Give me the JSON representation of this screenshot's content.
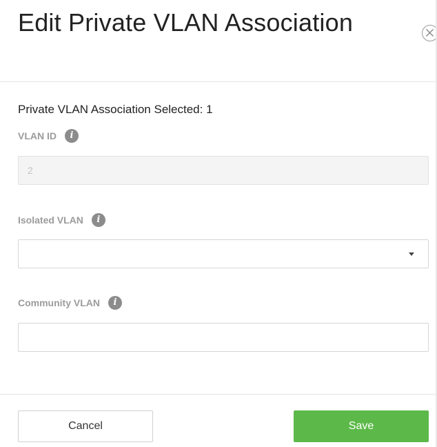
{
  "dialog": {
    "title": "Edit Private VLAN Association",
    "close_icon": "close-circle-icon",
    "selected_text": "Private VLAN Association Selected: 1"
  },
  "fields": {
    "vlan_id": {
      "label": "VLAN ID",
      "value": "2",
      "info_icon": "info-icon",
      "disabled": true
    },
    "isolated_vlan": {
      "label": "Isolated VLAN",
      "value": "",
      "info_icon": "info-icon",
      "type": "dropdown"
    },
    "community_vlan": {
      "label": "Community VLAN",
      "value": "",
      "info_icon": "info-icon",
      "type": "text"
    }
  },
  "footer": {
    "cancel_label": "Cancel",
    "save_label": "Save"
  },
  "colors": {
    "save_button": "#5cb949",
    "label": "#9b9b9b",
    "info_icon": "#8c8c8c"
  }
}
